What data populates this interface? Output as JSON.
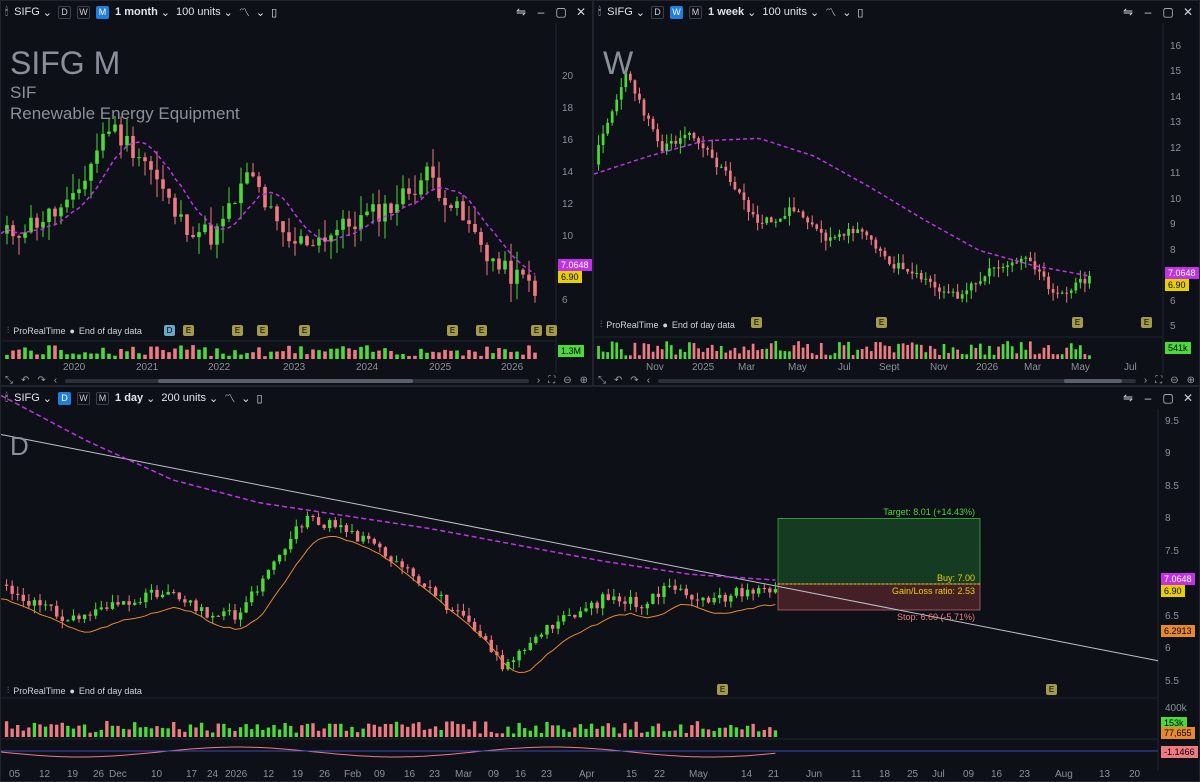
{
  "colors": {
    "bg": "#0d1016",
    "up": "#4cd93a",
    "down": "#f07a82",
    "ma": "#c032e6",
    "trend": "#bfc3c9",
    "accent": "#1f7fe0",
    "band": "#e8892b"
  },
  "panels": {
    "monthly": {
      "ticker": "SIFG",
      "timeframes": [
        "D",
        "W",
        "M"
      ],
      "active_tf": "M",
      "period": "1 month",
      "units": "100 units",
      "title_big": "SIFG  M",
      "symbol": "SIF",
      "industry": "Renewable Energy Equipment",
      "source_label": "ProRealTime",
      "eod_label": "End of day data",
      "price_axis": [
        "20",
        "18",
        "16",
        "14",
        "12",
        "10",
        "8",
        "6"
      ],
      "last_price_ma": "7.0648",
      "last_price": "6.90",
      "volume_label": "1.3M",
      "time_axis": [
        "2020",
        "2021",
        "2022",
        "2023",
        "2024",
        "2025",
        "2026"
      ],
      "events": [
        "D",
        "E",
        "E",
        "E",
        "E",
        "E",
        "E",
        "E",
        "E"
      ]
    },
    "weekly": {
      "ticker": "SIFG",
      "timeframes": [
        "D",
        "W",
        "M"
      ],
      "active_tf": "W",
      "period": "1 week",
      "units": "100 units",
      "title_big": "W",
      "source_label": "ProRealTime",
      "eod_label": "End of day data",
      "price_axis": [
        "16",
        "15",
        "14",
        "13",
        "12",
        "11",
        "10",
        "9",
        "8",
        "7",
        "6",
        "5"
      ],
      "last_price_ma": "7.0648",
      "last_price": "6.90",
      "volume_label": "541k",
      "time_axis": [
        "Nov",
        "2025",
        "Mar",
        "May",
        "Jul",
        "Sept",
        "Nov",
        "2026",
        "Mar",
        "May",
        "Jul"
      ],
      "events": [
        "E",
        "E",
        "E",
        "E"
      ]
    },
    "daily": {
      "ticker": "SIFG",
      "timeframes": [
        "D",
        "W",
        "M"
      ],
      "active_tf": "D",
      "period": "1 day",
      "units": "200 units",
      "title_big": "D",
      "source_label": "ProRealTime",
      "eod_label": "End of day data",
      "price_axis": [
        "9.5",
        "9",
        "8.5",
        "8",
        "7.5",
        "7",
        "6.5",
        "6",
        "5.5"
      ],
      "last_price_ma": "7.0648",
      "last_price": "6.90",
      "lower_band": "6.2913",
      "target_label": "Target: 8.01 (+14.43%)",
      "buy_label": "Buy: 7.00",
      "ratio_label": "Gain/Loss ratio: 2.53",
      "stop_label": "Stop: 6.60 (-5.71%)",
      "volume_axis": "400k",
      "volume_label": "153k",
      "volume_ma": "77,655",
      "osc_label": "-1.1466",
      "time_axis": [
        "05",
        "12",
        "19",
        "26",
        "Dec",
        "10",
        "17",
        "24",
        "2026",
        "12",
        "19",
        "26",
        "Feb",
        "09",
        "16",
        "23",
        "Mar",
        "09",
        "16",
        "23",
        "Apr",
        "15",
        "22",
        "May",
        "14",
        "21",
        "Jun",
        "11",
        "18",
        "25",
        "Jul",
        "09",
        "16",
        "23",
        "Aug",
        "13",
        "20"
      ],
      "events": [
        "E",
        "E"
      ]
    }
  }
}
